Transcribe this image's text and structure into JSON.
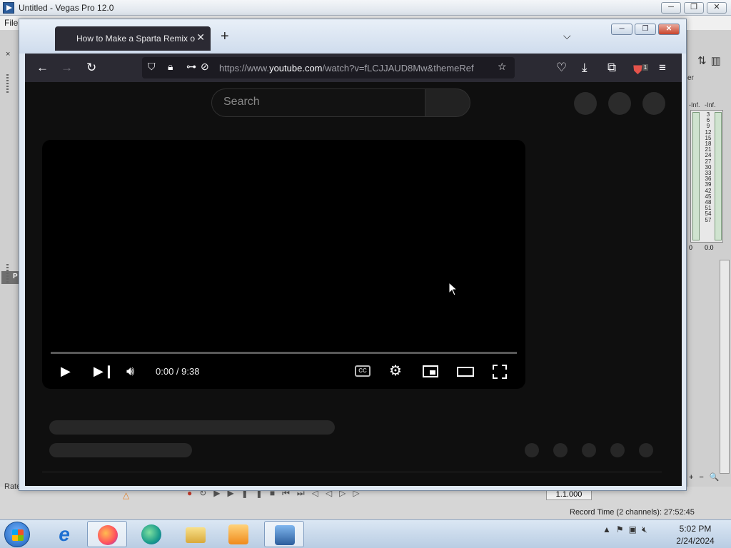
{
  "vegas": {
    "title": "Untitled - Vegas Pro 12.0",
    "menu_file": "File",
    "min_btn": "─",
    "max_btn": "❐",
    "close_btn": "✕",
    "left_close": "×",
    "left_tab": "P",
    "mixer_label": "er",
    "meter_inf_left": "-Inf.",
    "meter_inf_right": "-Inf.",
    "meter_scale": [
      "3",
      "6",
      "9",
      "12",
      "15",
      "18",
      "21",
      "24",
      "27",
      "30",
      "33",
      "36",
      "39",
      "42",
      "45",
      "48",
      "51",
      "54",
      "57"
    ],
    "meter_zero_left": "0",
    "meter_zero_right": "0.0",
    "rate_label": "Rate",
    "timecode": "1.1.000",
    "record_time": "Record Time (2 channels): 27:52:45"
  },
  "browser": {
    "tab_title": "How to Make a Sparta Remix or",
    "tab_close": "✕",
    "new_tab": "+",
    "tab_list": "⌵",
    "url_prefix": "https://www.",
    "url_host": "youtube.com",
    "url_path": "/watch?v=fLCJJAUD8Mw&themeRef",
    "extension_badge": "1",
    "window_buttons": {
      "minimize": "─",
      "restore": "❐",
      "close": "✕"
    }
  },
  "youtube": {
    "search_placeholder": "Search",
    "player": {
      "current_time": "0:00",
      "duration": "9:38",
      "time_display": "0:00 / 9:38",
      "progress_fraction": 0.0,
      "cc_label": "CC"
    }
  },
  "taskbar": {
    "time": "5:02 PM",
    "date": "2/24/2024",
    "apps": [
      "internet-explorer",
      "firefox",
      "edge",
      "file-explorer",
      "media-player",
      "vegas-pro"
    ]
  },
  "colors": {
    "firefox_chrome": "#2b2a33",
    "youtube_bg": "#0f0f0f",
    "progress_red": "#ff0000"
  }
}
